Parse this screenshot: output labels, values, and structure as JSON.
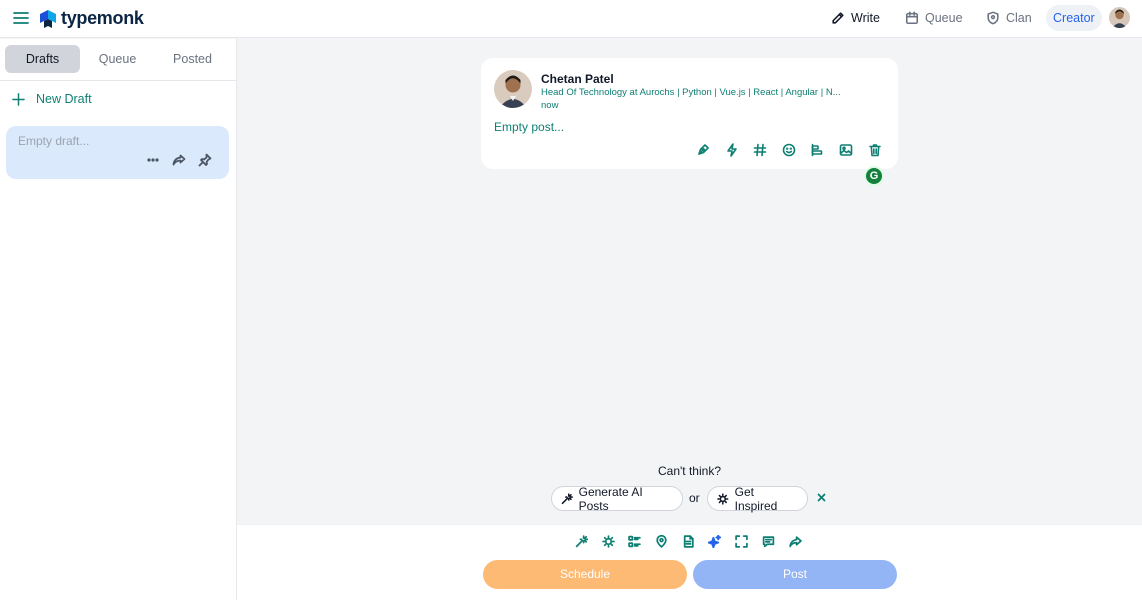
{
  "app": {
    "brand": "typemonk"
  },
  "topnav": {
    "write": "Write",
    "queue": "Queue",
    "clan": "Clan",
    "creator": "Creator"
  },
  "sidebar": {
    "tabs": [
      {
        "label": "Drafts",
        "active": true
      },
      {
        "label": "Queue",
        "active": false
      },
      {
        "label": "Posted",
        "active": false
      }
    ],
    "new_draft": "New Draft",
    "drafts": [
      {
        "text": "Empty draft...",
        "more": "···"
      }
    ]
  },
  "post": {
    "author": "Chetan Patel",
    "headline": "Head Of Technology at Aurochs | Python | Vue.js | React | Angular | N...",
    "time": "now",
    "body": "Empty post...",
    "tools": [
      "write-with-ai-icon",
      "lightning-icon",
      "hashtag-icon",
      "emoji-icon",
      "format-icon",
      "image-icon",
      "trash-icon"
    ]
  },
  "suggestions": {
    "question": "Can't think?",
    "generate": "Generate AI Posts",
    "or": "or",
    "inspire": "Get Inspired",
    "close": "×"
  },
  "composer_tools": [
    "magic-wand-icon",
    "idea-icon",
    "list-icon",
    "location-icon",
    "document-icon",
    "sparkle-icon",
    "expand-icon",
    "comment-icon",
    "share-icon"
  ],
  "actions": {
    "schedule": "Schedule",
    "post": "Post"
  },
  "colors": {
    "accent": "#0e7f73",
    "brand_dark": "#0b2545",
    "draft_bg": "#dbe9fc",
    "schedule_btn": "#fdba74",
    "post_btn": "#93b4f5",
    "creator_text": "#2563eb"
  }
}
